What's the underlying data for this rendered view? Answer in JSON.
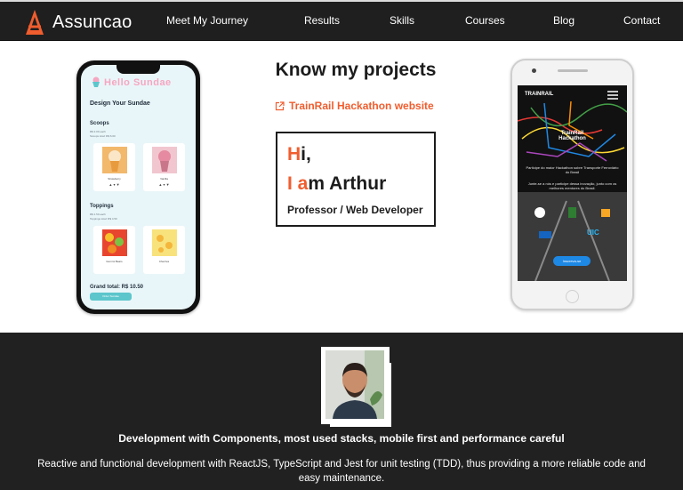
{
  "nav": {
    "brand": "Assuncao",
    "links": [
      "Meet My Journey",
      "Results",
      "Skills",
      "Courses",
      "Blog",
      "Contact"
    ]
  },
  "hero": {
    "title": "Know my projects",
    "project_link": "TrainRail Hackathon website",
    "intro": {
      "line1_accent": "H",
      "line1_rest": "i,",
      "line2_accent": "I a",
      "line2_rest": "m Arthur",
      "role": "Professor / Web Developer"
    }
  },
  "sundae_app": {
    "logo_text": "Hello Sundae",
    "heading": "Design Your Sundae",
    "scoops_title": "Scoops",
    "scoops_price": "R$ 2.00 each",
    "scoops_total": "Scoops total: R$ 6.00",
    "scoops": [
      "Strawberry",
      "Vanilla"
    ],
    "toppings_title": "Toppings",
    "toppings_price": "R$ 1.50 each",
    "toppings_total": "Toppings total: R$ 4.50",
    "toppings": [
      "Gummi Bears",
      "Cherries"
    ],
    "grand_total": "Grand total: R$ 10.50",
    "order_button": "Order Sundae"
  },
  "trainrail_app": {
    "logo": "TRAINRAIL",
    "heading_line1": "TrainRail",
    "heading_line2": "Hackathon",
    "text1": "Participe do maior Hackathon sobre Transporte Ferroviário do Brasil",
    "text2": "Junte-se a nós e participe dessa inovação, junto com os melhores mentores do Brasil.",
    "cta": "Inscreva-se",
    "sponsor": "UIC"
  },
  "about": {
    "title": "Development with Components, most used stacks, mobile first and performance careful",
    "description": "Reactive and functional development with ReactJS, TypeScript and Jest for unit testing (TDD), thus providing a more reliable code and easy maintenance."
  },
  "colors": {
    "accent": "#f05d2e",
    "nav_bg": "#1f1f1f",
    "about_bg": "#212121"
  }
}
